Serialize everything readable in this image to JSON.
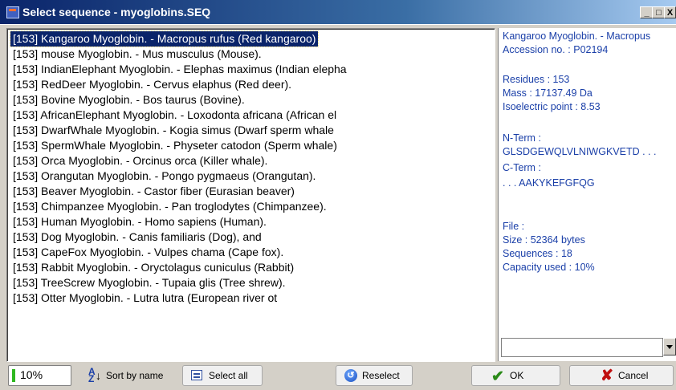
{
  "window": {
    "title": "Select sequence - myoglobins.SEQ",
    "min_glyph": "_",
    "max_glyph": "□",
    "close_glyph": "X"
  },
  "sequences": [
    "[153] Kangaroo Myoglobin. - Macropus rufus (Red kangaroo)",
    "[153] mouse Myoglobin. - Mus musculus (Mouse).",
    "[153] IndianElephant Myoglobin. - Elephas maximus (Indian elepha",
    "[153] RedDeer Myoglobin. - Cervus elaphus (Red deer).",
    "[153] Bovine Myoglobin. - Bos taurus (Bovine).",
    "[153] AfricanElephant Myoglobin. - Loxodonta africana (African el",
    "[153] DwarfWhale Myoglobin. - Kogia simus (Dwarf sperm whale",
    "[153] SpermWhale Myoglobin. - Physeter catodon (Sperm whale)",
    "[153] Orca Myoglobin. - Orcinus orca (Killer whale).",
    "[153] Orangutan Myoglobin. - Pongo pygmaeus (Orangutan).",
    "[153] Beaver Myoglobin. - Castor fiber (Eurasian beaver)",
    "[153] Chimpanzee Myoglobin. - Pan troglodytes (Chimpanzee).",
    "[153] Human Myoglobin. - Homo sapiens (Human).",
    "[153] Dog Myoglobin. - Canis familiaris (Dog), and",
    "[153] CapeFox Myoglobin. - Vulpes chama (Cape fox).",
    "[153] Rabbit Myoglobin. - Oryctolagus cuniculus (Rabbit)",
    "[153] TreeScrew Myoglobin. - Tupaia glis (Tree shrew).",
    "[153] Otter Myoglobin. - Lutra lutra (European river ot"
  ],
  "selected_index": 0,
  "info": {
    "name": "Kangaroo Myoglobin. - Macropus",
    "accession": "Accession no. : P02194",
    "residues": "Residues : 153",
    "mass": "Mass :  17137.49 Da",
    "pi": "Isoelectric point :  8.53",
    "nterm_label": "N-Term :",
    "nterm_seq": "GLSDGEWQLVLNIWGKVETD . . .",
    "cterm_label": "C-Term :",
    "cterm_seq": ". . . AAKYKEFGFQG",
    "file_label": "File :",
    "size": "Size : 52364 bytes",
    "sequences": "Sequences : 18",
    "capacity": "Capacity used :  10%"
  },
  "capacity_fraction": 0.1,
  "toolbar": {
    "progress_label": "10%",
    "sort_label": "Sort by name",
    "select_all_label": "Select all",
    "reselect_label": "Reselect",
    "ok_label": "OK",
    "cancel_label": "Cancel"
  },
  "icons": {
    "sort": "sort-az-icon",
    "select_all": "select-all-icon",
    "reselect": "reselect-icon",
    "ok": "check-icon",
    "cancel": "x-icon"
  },
  "colors": {
    "selection": "#0a246a",
    "info_text": "#1a3fa8",
    "ok_check": "#2a8a18",
    "cancel_x": "#c01010"
  }
}
